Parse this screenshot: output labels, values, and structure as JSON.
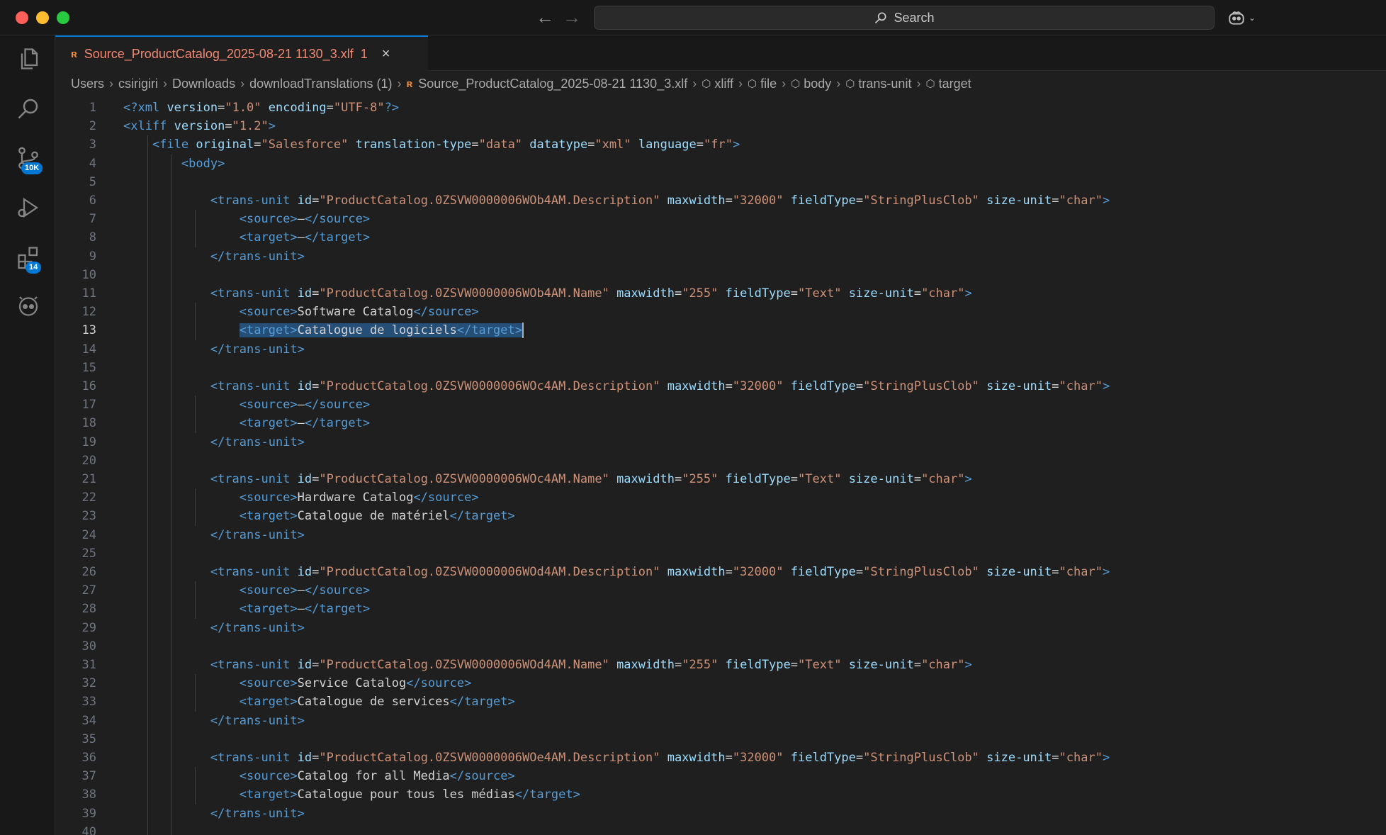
{
  "titlebar": {
    "search_label": "Search"
  },
  "activity_bar": {
    "items": [
      {
        "name": "explorer",
        "icon": "files-icon"
      },
      {
        "name": "search",
        "icon": "search-icon"
      },
      {
        "name": "source-control",
        "icon": "source-control-icon",
        "badge": "10K"
      },
      {
        "name": "run-debug",
        "icon": "run-debug-icon"
      },
      {
        "name": "extensions",
        "icon": "extensions-icon",
        "badge": "14"
      },
      {
        "name": "copilot",
        "icon": "copilot-icon"
      }
    ]
  },
  "tab": {
    "label": "Source_ProductCatalog_2025-08-21 1130_3.xlf",
    "problems": "1",
    "close": "×"
  },
  "breadcrumb": [
    "Users",
    "csirigiri",
    "Downloads",
    "downloadTranslations (1)",
    "Source_ProductCatalog_2025-08-21 1130_3.xlf",
    "xliff",
    "file",
    "body",
    "trans-unit",
    "target"
  ],
  "editor": {
    "active_line": 13,
    "lines": [
      "<?xml version=\"1.0\" encoding=\"UTF-8\"?>",
      "<xliff version=\"1.2\">",
      "    <file original=\"Salesforce\" translation-type=\"data\" datatype=\"xml\" language=\"fr\">",
      "        <body>",
      "",
      "            <trans-unit id=\"ProductCatalog.0ZSVW0000006WOb4AM.Description\" maxwidth=\"32000\" fieldType=\"StringPlusClob\" size-unit=\"char\">",
      "                <source>–</source>",
      "                <target>–</target>",
      "            </trans-unit>",
      "",
      "            <trans-unit id=\"ProductCatalog.0ZSVW0000006WOb4AM.Name\" maxwidth=\"255\" fieldType=\"Text\" size-unit=\"char\">",
      "                <source>Software Catalog</source>",
      "                <target>Catalogue de logiciels</target>",
      "            </trans-unit>",
      "",
      "            <trans-unit id=\"ProductCatalog.0ZSVW0000006WOc4AM.Description\" maxwidth=\"32000\" fieldType=\"StringPlusClob\" size-unit=\"char\">",
      "                <source>–</source>",
      "                <target>–</target>",
      "            </trans-unit>",
      "",
      "            <trans-unit id=\"ProductCatalog.0ZSVW0000006WOc4AM.Name\" maxwidth=\"255\" fieldType=\"Text\" size-unit=\"char\">",
      "                <source>Hardware Catalog</source>",
      "                <target>Catalogue de matériel</target>",
      "            </trans-unit>",
      "",
      "            <trans-unit id=\"ProductCatalog.0ZSVW0000006WOd4AM.Description\" maxwidth=\"32000\" fieldType=\"StringPlusClob\" size-unit=\"char\">",
      "                <source>–</source>",
      "                <target>–</target>",
      "            </trans-unit>",
      "",
      "            <trans-unit id=\"ProductCatalog.0ZSVW0000006WOd4AM.Name\" maxwidth=\"255\" fieldType=\"Text\" size-unit=\"char\">",
      "                <source>Service Catalog</source>",
      "                <target>Catalogue de services</target>",
      "            </trans-unit>",
      "",
      "            <trans-unit id=\"ProductCatalog.0ZSVW0000006WOe4AM.Description\" maxwidth=\"32000\" fieldType=\"StringPlusClob\" size-unit=\"char\">",
      "                <source>Catalog for all Media</source>",
      "                <target>Catalogue pour tous les médias</target>",
      "            </trans-unit>",
      ""
    ]
  }
}
